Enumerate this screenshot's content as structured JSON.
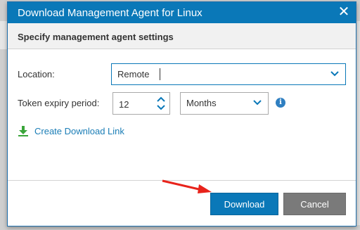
{
  "dialog": {
    "title": "Download Management Agent for Linux",
    "subheader": "Specify management agent settings"
  },
  "form": {
    "location_label": "Location:",
    "location_value": "Remote",
    "token_label": "Token expiry period:",
    "token_value": "12",
    "period_value": "Months"
  },
  "link": {
    "label": "Create Download Link"
  },
  "buttons": {
    "download": "Download",
    "cancel": "Cancel"
  },
  "colors": {
    "accent": "#0a78b8",
    "link": "#1a7db6",
    "secondary_button": "#7a7a7a",
    "download_icon": "#3aa53a",
    "annotation_arrow": "#e8231b"
  },
  "icons": {
    "close": "close-icon",
    "chevron": "chevron-down-icon",
    "spin_up": "chevron-up-icon",
    "spin_down": "chevron-down-icon",
    "info": "info-icon",
    "download": "download-icon"
  }
}
